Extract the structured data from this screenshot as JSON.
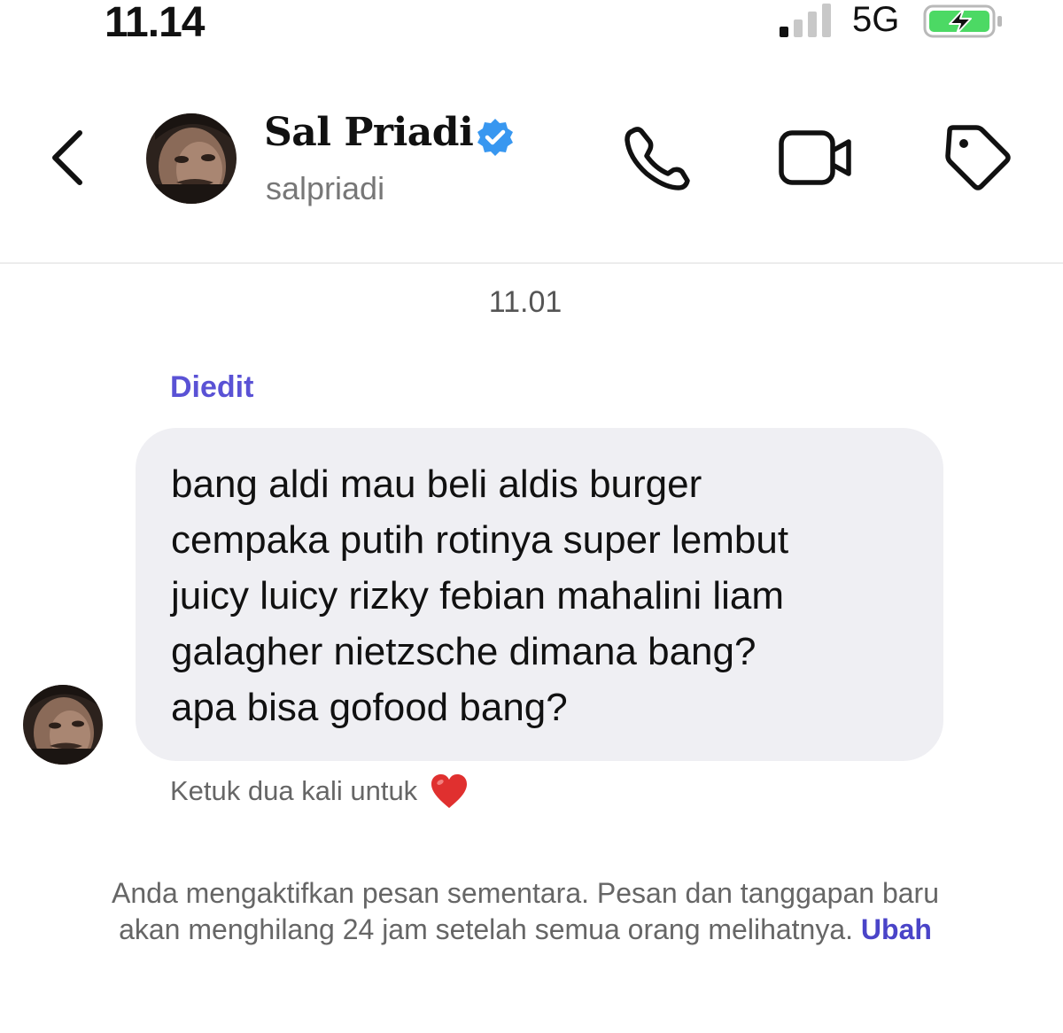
{
  "status_bar": {
    "time": "11.14",
    "network": "5G",
    "battery_color": "#4cd964"
  },
  "header": {
    "name": "Sal Priadi",
    "username": "salpriadi",
    "verified": true,
    "verified_color": "#3897f0",
    "icons": [
      "back-icon",
      "phone-icon",
      "video-icon",
      "tag-icon"
    ]
  },
  "conversation": {
    "timestamp": "11.01",
    "edited_label": "Diedit",
    "message_lines": [
      "bang aldi mau beli aldis burger",
      "cempaka putih rotinya super lembut",
      "juicy luicy rizky febian mahalini liam",
      "galagher nietzsche dimana bang?",
      "apa bisa gofood bang?"
    ],
    "reaction_hint": "Ketuk dua kali untuk",
    "reaction_icon": "heart-icon",
    "heart_color": "#e0302f"
  },
  "notice": {
    "text": "Anda mengaktifkan pesan sementara. Pesan dan tanggapan baru akan menghilang 24 jam setelah semua orang melihatnya.",
    "link": "Ubah"
  },
  "colors": {
    "edited": "#5a52d5",
    "bubble": "#efeff3",
    "link": "#4a44c8"
  }
}
